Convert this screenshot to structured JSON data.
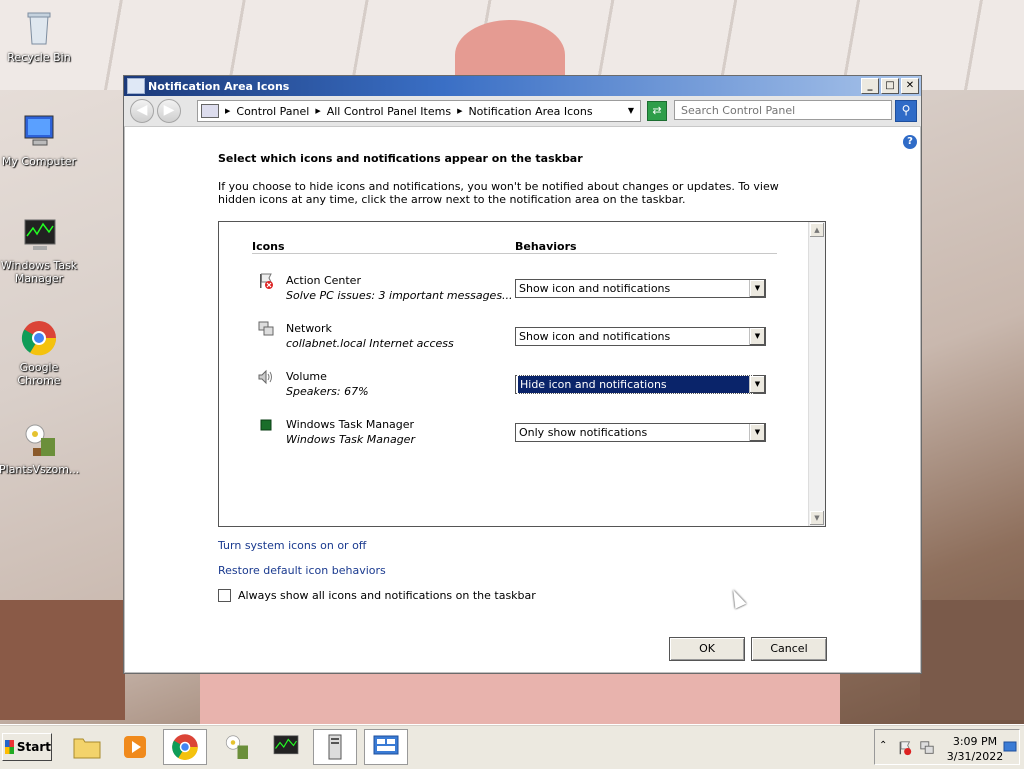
{
  "desktop": {
    "icons": [
      {
        "label": "Recycle Bin",
        "icon": "recycle-bin-icon"
      },
      {
        "label": "My Computer",
        "icon": "my-computer-icon"
      },
      {
        "label": "Windows Task Manager",
        "icon": "task-manager-icon"
      },
      {
        "label": "Google Chrome",
        "icon": "chrome-icon"
      },
      {
        "label": "PlantsVszom...",
        "icon": "plants-vs-zombies-icon"
      }
    ]
  },
  "window": {
    "title": "Notification Area Icons",
    "controls": {
      "minimize": "_",
      "maximize": "□",
      "close": "✕"
    },
    "breadcrumb": [
      "Control Panel",
      "All Control Panel Items",
      "Notification Area Icons"
    ],
    "search_placeholder": "Search Control Panel",
    "heading": "Select which icons and notifications appear on the taskbar",
    "description": "If you choose to hide icons and notifications, you won't be notified about changes or updates. To view hidden icons at any time, click the arrow next to the notification area on the taskbar.",
    "columns": {
      "icons": "Icons",
      "behaviors": "Behaviors"
    },
    "rows": [
      {
        "name": "Action Center",
        "subtitle": "Solve PC issues: 3 important messages...",
        "behavior": "Show icon and notifications",
        "icon": "action-center-flag-icon"
      },
      {
        "name": "Network",
        "subtitle": "collabnet.local Internet access",
        "behavior": "Show icon and notifications",
        "icon": "network-icon"
      },
      {
        "name": "Volume",
        "subtitle": "Speakers: 67%",
        "behavior": "Hide icon and notifications",
        "icon": "speaker-icon"
      },
      {
        "name": "Windows Task Manager",
        "subtitle": "Windows Task Manager",
        "behavior": "Only show notifications",
        "icon": "task-manager-tray-icon"
      }
    ],
    "selected_row": 2,
    "links": {
      "system_icons": "Turn system icons on or off",
      "restore": "Restore default icon behaviors"
    },
    "always_show_label": "Always show all icons and notifications on the taskbar",
    "always_show_checked": false,
    "ok_label": "OK",
    "cancel_label": "Cancel"
  },
  "taskbar": {
    "start_label": "Start",
    "time": "3:09 PM",
    "date": "3/31/2022"
  },
  "colors": {
    "accent": "#0a246a",
    "link": "#1a3a8f",
    "titlebar": "#1c3a7a"
  }
}
